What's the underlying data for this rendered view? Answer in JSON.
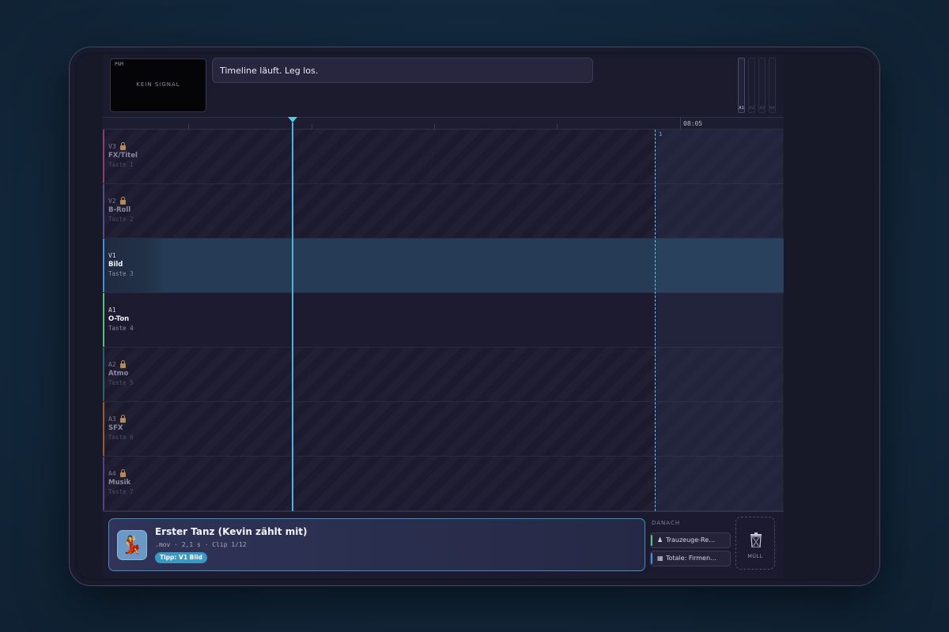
{
  "monitor": {
    "label": "PGM",
    "status": "KEIN SIGNAL"
  },
  "status_message": "Timeline läuft. Leg los.",
  "meters": [
    "A1",
    "A2",
    "A3",
    "A4"
  ],
  "ruler": {
    "timecode": "08:05"
  },
  "marker": {
    "number": "1"
  },
  "tracks": [
    {
      "id": "V3",
      "name": "FX/Titel",
      "key": "Taste 1",
      "locked": true,
      "color": "#8a3f74"
    },
    {
      "id": "V2",
      "name": "B-Roll",
      "key": "Taste 2",
      "locked": true,
      "color": "#5a4a8a"
    },
    {
      "id": "V1",
      "name": "Bild",
      "key": "Taste 3",
      "locked": false,
      "color": "#4a8fd6"
    },
    {
      "id": "A1",
      "name": "O-Ton",
      "key": "Taste 4",
      "locked": false,
      "color": "#53c27e"
    },
    {
      "id": "A2",
      "name": "Atmo",
      "key": "Taste 5",
      "locked": true,
      "color": "#2f5f6a"
    },
    {
      "id": "A3",
      "name": "SFX",
      "key": "Taste 6",
      "locked": true,
      "color": "#9a5a35"
    },
    {
      "id": "A4",
      "name": "Musik",
      "key": "Taste 7",
      "locked": true,
      "color": "#5b3f88"
    }
  ],
  "clip": {
    "icon": "💃",
    "title": "Erster Tanz (Kevin zählt mit)",
    "meta": ".mov · 2,1 s · Clip 1/12",
    "tip": "Tipp: V1 Bild"
  },
  "next": {
    "label": "DANACH",
    "items": [
      {
        "icon": "person-icon",
        "text": "Trauzeuge-Re…",
        "color": "#53c27e"
      },
      {
        "icon": "building-icon",
        "text": "Totale: Firmen…",
        "color": "#4a8fd6"
      }
    ]
  },
  "trash": {
    "label": "MÜLL"
  }
}
